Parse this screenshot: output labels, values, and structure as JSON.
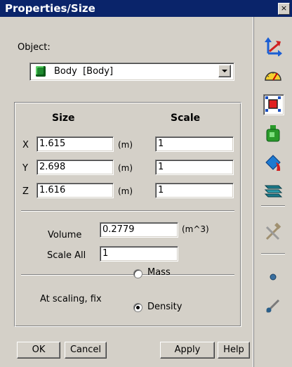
{
  "window": {
    "title": "Properties/Size",
    "close_glyph": "×"
  },
  "object": {
    "label": "Object:",
    "selected": "Body  [Body]",
    "icon": "green-cube-icon"
  },
  "size_section": {
    "size_header": "Size",
    "scale_header": "Scale",
    "rows": [
      {
        "axis": "X",
        "size": "1.615",
        "unit": "(m)",
        "scale": "1"
      },
      {
        "axis": "Y",
        "size": "2.698",
        "unit": "(m)",
        "scale": "1"
      },
      {
        "axis": "Z",
        "size": "1.616",
        "unit": "(m)",
        "scale": "1"
      }
    ]
  },
  "volume": {
    "label": "Volume",
    "value": "0.2779",
    "unit": "(m^3)"
  },
  "scale_all": {
    "label": "Scale All",
    "value": "1"
  },
  "fix": {
    "label": "At scaling, fix",
    "options": [
      {
        "label": "Mass",
        "checked": false
      },
      {
        "label": "Density",
        "checked": true
      }
    ]
  },
  "buttons": {
    "ok": "OK",
    "cancel": "Cancel",
    "apply": "Apply",
    "help": "Help"
  },
  "toolbar": {
    "items": [
      "axes-icon",
      "gauge-icon",
      "resize-icon",
      "mass-weight-icon",
      "material-bucket-icon",
      "stack-layers-icon",
      "hammer-wrench-icon",
      "point-icon",
      "marker-icon"
    ]
  }
}
